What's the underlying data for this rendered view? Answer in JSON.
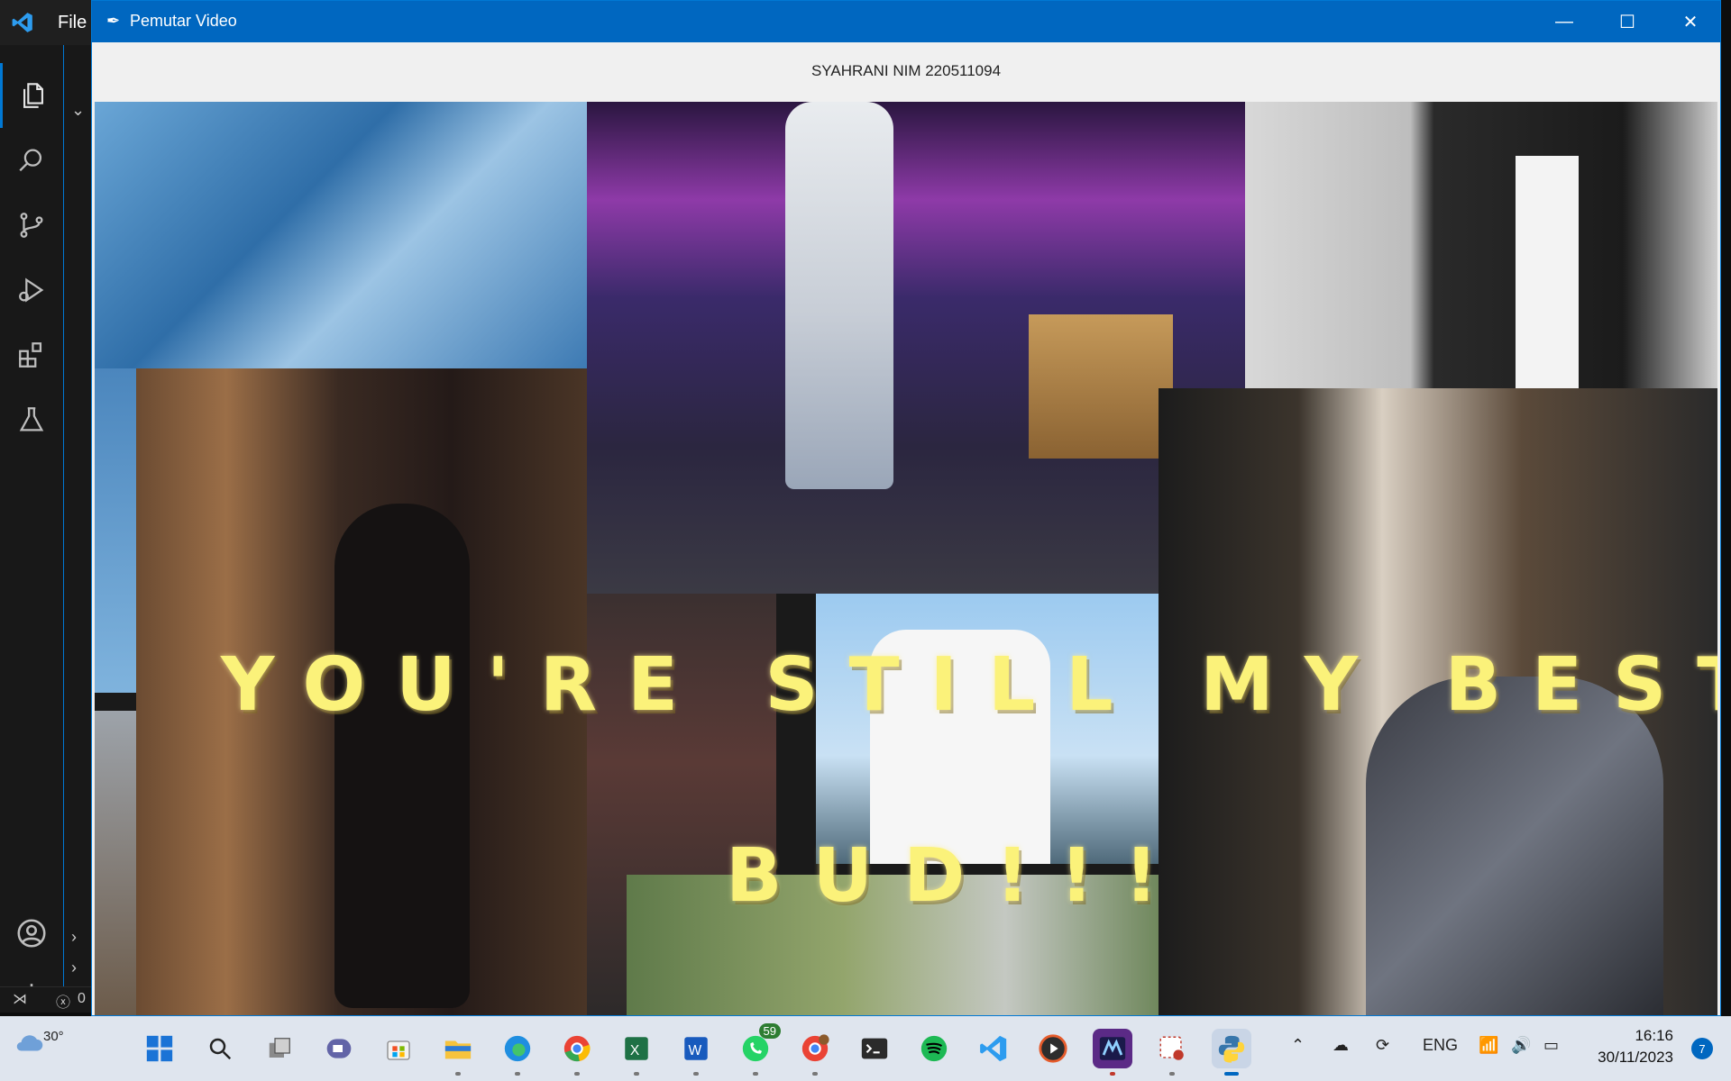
{
  "vscode": {
    "menu_file": "File",
    "status_errors": "0"
  },
  "window": {
    "title": "Pemutar Video",
    "caption": "SYAHRANI NIM 220511094"
  },
  "video": {
    "overlay_line1": "YOU'RE STILL MY BEST",
    "overlay_line2": "BUD!!!"
  },
  "taskbar": {
    "weather_temp": "30°",
    "whatsapp_badge": "59",
    "language": "ENG",
    "time": "16:16",
    "date": "30/11/2023",
    "notifications": "7"
  }
}
